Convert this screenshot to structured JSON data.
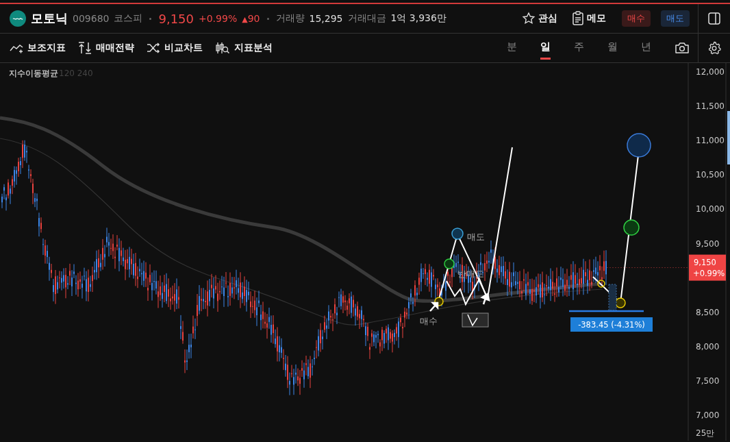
{
  "header": {
    "name": "모토닉",
    "code": "009680",
    "market": "코스피",
    "price": "9,150",
    "change_pct": "+0.99%",
    "change_arrow": "▲",
    "change": "90",
    "volume_label": "거래량",
    "volume": "15,295",
    "amount_label": "거래대금",
    "amount": "1억 3,936만",
    "watch": "관심",
    "memo": "메모",
    "buy": "매수",
    "sell": "매도"
  },
  "toolbar": {
    "tools": [
      "보조지표",
      "매매전략",
      "비교차트",
      "지표분석"
    ],
    "periods": [
      {
        "label": "분",
        "selected": false
      },
      {
        "label": "일",
        "selected": true
      },
      {
        "label": "주",
        "selected": false
      },
      {
        "label": "월",
        "selected": false
      },
      {
        "label": "년",
        "selected": false
      }
    ]
  },
  "chart": {
    "indicator": "지수이동평균",
    "indicator_params": "120 240",
    "y_labels": [
      "12,000",
      "11,500",
      "11,000",
      "10,500",
      "10,000",
      "9,500",
      "8,500",
      "8,000",
      "7,500",
      "7,000"
    ],
    "volume_label": "25만",
    "price_badge": {
      "price": "9,150",
      "change": "+0.99%"
    },
    "annotations": [
      {
        "kind": "label",
        "text": "매도"
      },
      {
        "kind": "label",
        "text": "반매도"
      },
      {
        "kind": "label",
        "text": "매수"
      }
    ],
    "measure": "-383.45 (-4.31%)"
  }
}
